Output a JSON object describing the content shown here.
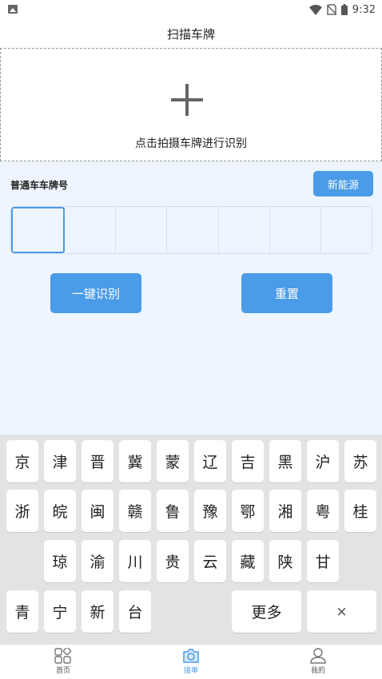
{
  "status_bar": {
    "time": "9:32"
  },
  "header": {
    "title": "扫描车牌"
  },
  "upload": {
    "hint": "点击拍摄车牌进行识别"
  },
  "plate_panel": {
    "label": "普通车车牌号",
    "new_energy_label": "新能源",
    "cell_count": 7
  },
  "actions": {
    "recognize_label": "一键识别",
    "reset_label": "重置"
  },
  "keyboard": {
    "row1": [
      "京",
      "津",
      "晋",
      "冀",
      "蒙",
      "辽",
      "吉",
      "黑",
      "沪",
      "苏"
    ],
    "row2": [
      "浙",
      "皖",
      "闽",
      "赣",
      "鲁",
      "豫",
      "鄂",
      "湘",
      "粤",
      "桂"
    ],
    "row3": [
      "琼",
      "渝",
      "川",
      "贵",
      "云",
      "藏",
      "陕",
      "甘"
    ],
    "row4": [
      "青",
      "宁",
      "新",
      "台"
    ],
    "more_label": "更多",
    "delete_label": "×"
  },
  "tabbar": {
    "tabs": [
      {
        "label": "首页",
        "icon": "home-grid-icon"
      },
      {
        "label": "接单",
        "icon": "camera-icon"
      },
      {
        "label": "我的",
        "icon": "user-icon"
      }
    ],
    "active_index": 1
  },
  "colors": {
    "accent": "#4a9be8",
    "panel_bg": "#eef5fe",
    "keyboard_bg": "#e3e3e3"
  }
}
